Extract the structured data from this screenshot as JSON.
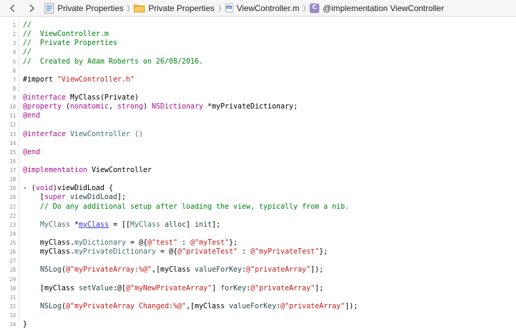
{
  "jumpbar": {
    "crumbs": [
      {
        "label": "Private Properties",
        "icon": "xcode-project-icon"
      },
      {
        "label": "Private Properties",
        "icon": "folder-icon"
      },
      {
        "label": "ViewController.m",
        "icon": "objc-m-file-icon",
        "glyph": "m"
      },
      {
        "label": "@implementation ViewController",
        "icon": "class-icon",
        "glyph": "C"
      }
    ]
  },
  "editor": {
    "lines": [
      {
        "n": "1",
        "tokens": [
          {
            "t": "//",
            "c": "comment"
          }
        ]
      },
      {
        "n": "2",
        "tokens": [
          {
            "t": "//  ViewController.m",
            "c": "comment"
          }
        ]
      },
      {
        "n": "3",
        "tokens": [
          {
            "t": "//  Private Properties",
            "c": "comment"
          }
        ]
      },
      {
        "n": "4",
        "tokens": [
          {
            "t": "//",
            "c": "comment"
          }
        ]
      },
      {
        "n": "5",
        "tokens": [
          {
            "t": "//  Created by Adam Roberts on 26/08/2016.",
            "c": "comment"
          }
        ]
      },
      {
        "n": "6",
        "tokens": []
      },
      {
        "n": "7",
        "tokens": [
          {
            "t": "#import ",
            "c": "plain"
          },
          {
            "t": "\"ViewController.h\"",
            "c": "string"
          }
        ]
      },
      {
        "n": "8",
        "tokens": []
      },
      {
        "n": "9",
        "tokens": [
          {
            "t": "@interface",
            "c": "kw"
          },
          {
            "t": " MyClass(Private)",
            "c": "plain"
          }
        ]
      },
      {
        "n": "10",
        "tokens": [
          {
            "t": "@property",
            "c": "kw"
          },
          {
            "t": " (",
            "c": "plain"
          },
          {
            "t": "nonatomic",
            "c": "kw"
          },
          {
            "t": ", ",
            "c": "plain"
          },
          {
            "t": "strong",
            "c": "kw"
          },
          {
            "t": ") ",
            "c": "plain"
          },
          {
            "t": "NSDictionary",
            "c": "kw"
          },
          {
            "t": " *myPrivateDictionary;",
            "c": "plain"
          }
        ]
      },
      {
        "n": "11",
        "tokens": [
          {
            "t": "@end",
            "c": "kw"
          }
        ]
      },
      {
        "n": "12",
        "tokens": []
      },
      {
        "n": "13",
        "tokens": [
          {
            "t": "@interface",
            "c": "kw"
          },
          {
            "t": " ViewController ()",
            "c": "type"
          }
        ]
      },
      {
        "n": "14",
        "tokens": []
      },
      {
        "n": "15",
        "tokens": [
          {
            "t": "@end",
            "c": "kw"
          }
        ]
      },
      {
        "n": "16",
        "tokens": []
      },
      {
        "n": "17",
        "tokens": [
          {
            "t": "@implementation",
            "c": "kw"
          },
          {
            "t": " ViewController",
            "c": "plain"
          }
        ]
      },
      {
        "n": "18",
        "tokens": []
      },
      {
        "n": "19",
        "tokens": [
          {
            "t": "- (",
            "c": "plain"
          },
          {
            "t": "void",
            "c": "kw"
          },
          {
            "t": ")viewDidLoad {",
            "c": "plain"
          }
        ]
      },
      {
        "n": "20",
        "tokens": [
          {
            "t": "    [",
            "c": "plain"
          },
          {
            "t": "super",
            "c": "kw"
          },
          {
            "t": " ",
            "c": "plain"
          },
          {
            "t": "viewDidLoad",
            "c": "method"
          },
          {
            "t": "];",
            "c": "plain"
          }
        ]
      },
      {
        "n": "21",
        "tokens": [
          {
            "t": "    // Do any additional setup after loading the view, typically from a nib.",
            "c": "comment"
          }
        ]
      },
      {
        "n": "22",
        "tokens": []
      },
      {
        "n": "23",
        "tokens": [
          {
            "t": "    ",
            "c": "plain"
          },
          {
            "t": "MyClass",
            "c": "type"
          },
          {
            "t": " *",
            "c": "plain"
          },
          {
            "t": "myClass",
            "c": "under"
          },
          {
            "t": " = [[",
            "c": "plain"
          },
          {
            "t": "MyClass",
            "c": "type"
          },
          {
            "t": " ",
            "c": "plain"
          },
          {
            "t": "alloc",
            "c": "method"
          },
          {
            "t": "] ",
            "c": "plain"
          },
          {
            "t": "init",
            "c": "method"
          },
          {
            "t": "];",
            "c": "plain"
          }
        ]
      },
      {
        "n": "24",
        "tokens": []
      },
      {
        "n": "25",
        "tokens": [
          {
            "t": "    myClass.",
            "c": "plain"
          },
          {
            "t": "myDictionary",
            "c": "prop"
          },
          {
            "t": " = @{",
            "c": "plain"
          },
          {
            "t": "@\"test\"",
            "c": "string"
          },
          {
            "t": " : ",
            "c": "plain"
          },
          {
            "t": "@\"myTest\"",
            "c": "string"
          },
          {
            "t": "};",
            "c": "plain"
          }
        ]
      },
      {
        "n": "26",
        "tokens": [
          {
            "t": "    myClass.",
            "c": "plain"
          },
          {
            "t": "myPrivateDictionary",
            "c": "prop"
          },
          {
            "t": " = @{",
            "c": "plain"
          },
          {
            "t": "@\"privateTest\"",
            "c": "string"
          },
          {
            "t": " : ",
            "c": "plain"
          },
          {
            "t": "@\"myPrivateTest\"",
            "c": "string"
          },
          {
            "t": "};",
            "c": "plain"
          }
        ]
      },
      {
        "n": "27",
        "tokens": []
      },
      {
        "n": "28",
        "tokens": [
          {
            "t": "    ",
            "c": "plain"
          },
          {
            "t": "NSLog",
            "c": "method"
          },
          {
            "t": "(",
            "c": "plain"
          },
          {
            "t": "@\"myPrivateArray:%@\"",
            "c": "string"
          },
          {
            "t": ",[myClass ",
            "c": "plain"
          },
          {
            "t": "valueForKey",
            "c": "method"
          },
          {
            "t": ":",
            "c": "plain"
          },
          {
            "t": "@\"privateArray\"",
            "c": "string"
          },
          {
            "t": "]);",
            "c": "plain"
          }
        ]
      },
      {
        "n": "29",
        "tokens": []
      },
      {
        "n": "30",
        "tokens": [
          {
            "t": "    [myClass ",
            "c": "plain"
          },
          {
            "t": "setValue",
            "c": "method"
          },
          {
            "t": ":@[",
            "c": "plain"
          },
          {
            "t": "@\"myNewPrivateArray\"",
            "c": "string"
          },
          {
            "t": "] ",
            "c": "plain"
          },
          {
            "t": "forKey",
            "c": "method"
          },
          {
            "t": ":",
            "c": "plain"
          },
          {
            "t": "@\"privateArray\"",
            "c": "string"
          },
          {
            "t": "];",
            "c": "plain"
          }
        ]
      },
      {
        "n": "31",
        "tokens": []
      },
      {
        "n": "32",
        "tokens": [
          {
            "t": "    ",
            "c": "plain"
          },
          {
            "t": "NSLog",
            "c": "method"
          },
          {
            "t": "(",
            "c": "plain"
          },
          {
            "t": "@\"myPrivateArray Changed:%@\"",
            "c": "string"
          },
          {
            "t": ",[myClass ",
            "c": "plain"
          },
          {
            "t": "valueForKey",
            "c": "method"
          },
          {
            "t": ":",
            "c": "plain"
          },
          {
            "t": "@\"privateArray\"",
            "c": "string"
          },
          {
            "t": "]);",
            "c": "plain"
          }
        ]
      },
      {
        "n": "33",
        "tokens": []
      },
      {
        "n": "34",
        "tokens": [
          {
            "t": "}",
            "c": "plain"
          }
        ]
      }
    ]
  }
}
